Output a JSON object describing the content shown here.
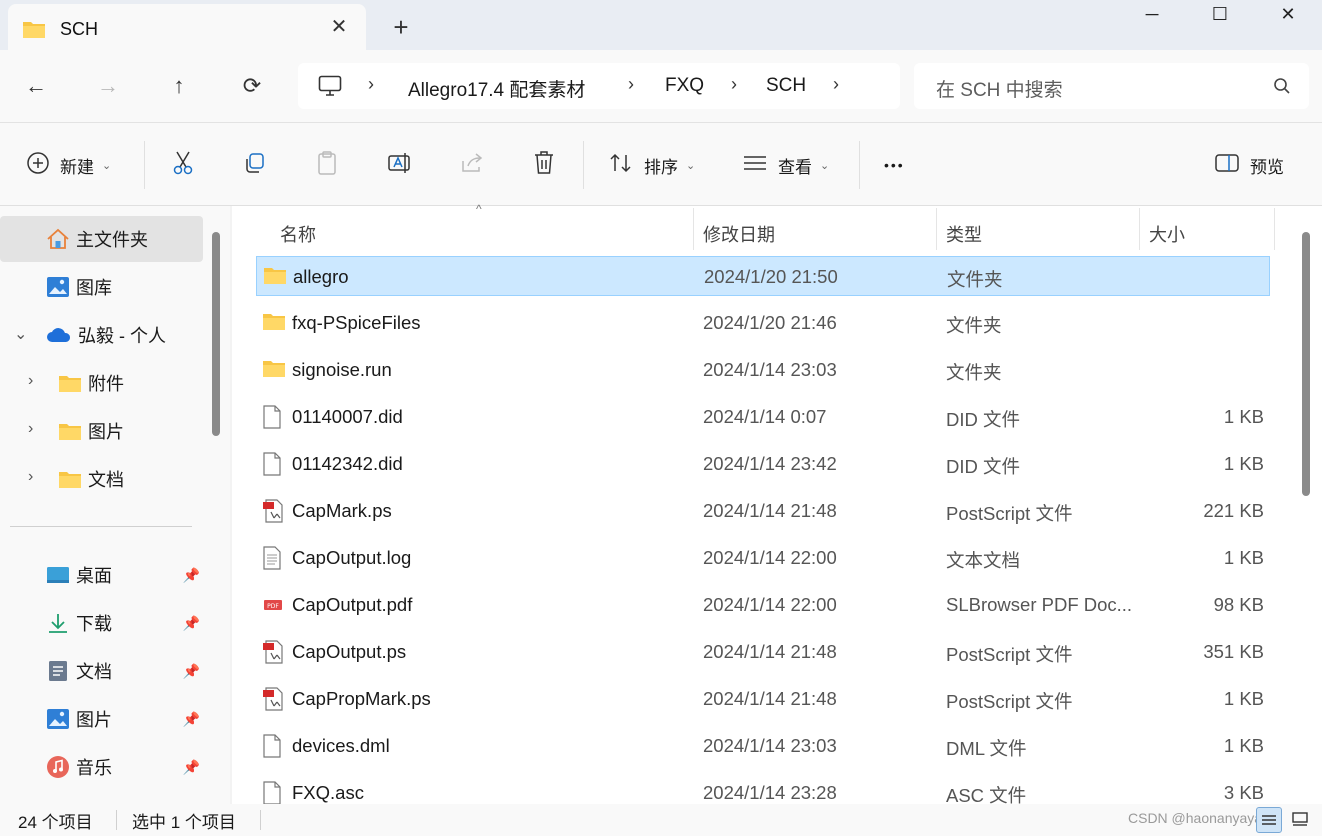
{
  "tab": {
    "title": "SCH",
    "close": "✕",
    "new": "+"
  },
  "window_controls": {
    "minimize": "─",
    "maximize": "☐",
    "close": "✕"
  },
  "nav": {
    "back": "←",
    "forward": "→",
    "up": "↑",
    "refresh": "⟳"
  },
  "address": {
    "separator": "›",
    "crumbs": [
      "Allegro17.4 配套素材",
      "FXQ",
      "SCH"
    ]
  },
  "search": {
    "placeholder": "在 SCH 中搜索"
  },
  "command": {
    "new_label": "新建",
    "sort_label": "排序",
    "view_label": "查看",
    "more_label": "•••",
    "preview_label": "预览",
    "chevron": "⌄"
  },
  "sidebar": {
    "home": "主文件夹",
    "gallery": "图库",
    "onedrive": "弘毅 - 个人",
    "onedrive_children": [
      "附件",
      "图片",
      "文档"
    ],
    "expander_closed": "›",
    "expander_open": "⌄",
    "pinned": [
      "桌面",
      "下载",
      "文档",
      "图片",
      "音乐"
    ]
  },
  "columns": {
    "name": "名称",
    "date": "修改日期",
    "type": "类型",
    "size": "大小",
    "sort_indicator": "^"
  },
  "files": [
    {
      "name": "allegro",
      "date": "2024/1/20 21:50",
      "type": "文件夹",
      "size": "",
      "icon": "folder-icon",
      "selected": true
    },
    {
      "name": "fxq-PSpiceFiles",
      "date": "2024/1/20 21:46",
      "type": "文件夹",
      "size": "",
      "icon": "folder-icon",
      "selected": false
    },
    {
      "name": "signoise.run",
      "date": "2024/1/14 23:03",
      "type": "文件夹",
      "size": "",
      "icon": "folder-icon",
      "selected": false
    },
    {
      "name": "01140007.did",
      "date": "2024/1/14 0:07",
      "type": "DID 文件",
      "size": "1 KB",
      "icon": "file-icon",
      "selected": false
    },
    {
      "name": "01142342.did",
      "date": "2024/1/14 23:42",
      "type": "DID 文件",
      "size": "1 KB",
      "icon": "file-icon",
      "selected": false
    },
    {
      "name": "CapMark.ps",
      "date": "2024/1/14 21:48",
      "type": "PostScript 文件",
      "size": "221 KB",
      "icon": "postscript-icon",
      "selected": false
    },
    {
      "name": "CapOutput.log",
      "date": "2024/1/14 22:00",
      "type": "文本文档",
      "size": "1 KB",
      "icon": "text-file-icon",
      "selected": false
    },
    {
      "name": "CapOutput.pdf",
      "date": "2024/1/14 22:00",
      "type": "SLBrowser PDF Doc...",
      "size": "98 KB",
      "icon": "pdf-icon",
      "selected": false
    },
    {
      "name": "CapOutput.ps",
      "date": "2024/1/14 21:48",
      "type": "PostScript 文件",
      "size": "351 KB",
      "icon": "postscript-icon",
      "selected": false
    },
    {
      "name": "CapPropMark.ps",
      "date": "2024/1/14 21:48",
      "type": "PostScript 文件",
      "size": "1 KB",
      "icon": "postscript-icon",
      "selected": false
    },
    {
      "name": "devices.dml",
      "date": "2024/1/14 23:03",
      "type": "DML 文件",
      "size": "1 KB",
      "icon": "file-icon",
      "selected": false
    },
    {
      "name": "FXQ.asc",
      "date": "2024/1/14 23:28",
      "type": "ASC 文件",
      "size": "3 KB",
      "icon": "file-icon",
      "selected": false
    }
  ],
  "status": {
    "count": "24 个项目",
    "selection": "选中 1 个项目"
  },
  "watermark": "CSDN @haonanyayaya",
  "colors": {
    "selection_bg": "#cce8ff",
    "selection_border": "#99d1ff",
    "folder": "#f8c645"
  }
}
